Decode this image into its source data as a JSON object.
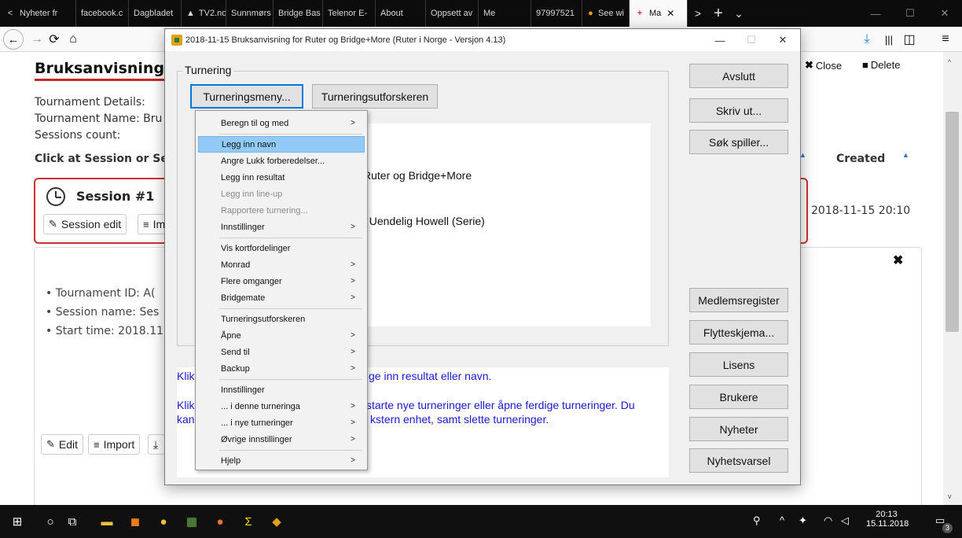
{
  "browser": {
    "tabs": [
      {
        "label": "Nyheter fr",
        "icon": "arrow-left-icon"
      },
      {
        "label": "facebook.c",
        "icon": ""
      },
      {
        "label": "Dagbladet",
        "icon": ""
      },
      {
        "label": "TV2.no",
        "icon": "warning-icon"
      },
      {
        "label": "Sunnmørs",
        "icon": ""
      },
      {
        "label": "Bridge Bas",
        "icon": ""
      },
      {
        "label": "Telenor E-",
        "icon": ""
      },
      {
        "label": "About",
        "icon": ""
      },
      {
        "label": "Oppsett av",
        "icon": ""
      },
      {
        "label": "Me",
        "icon": ""
      },
      {
        "label": "97997521",
        "icon": ""
      },
      {
        "label": "See wi",
        "icon": "firefox-icon"
      },
      {
        "label": "Ma",
        "icon": "plus-icon",
        "active": true
      }
    ],
    "new_tab": "+",
    "tab_overflow": ">",
    "tab_list": "⌄",
    "win_min": "—",
    "win_max": "☐",
    "win_close": "✕"
  },
  "page": {
    "title": "Bruksanvisning fo",
    "tournament_details": "Tournament Details:",
    "tournament_name": "Tournament Name: Bru",
    "sessions_count": "Sessions count:",
    "click_heading": "Click at Session or Sec",
    "created_header": "Created",
    "close_btn": "Close",
    "delete_btn": "Delete",
    "session": {
      "title": "Session #1",
      "edit_btn": "Session edit",
      "import_btn": "Im",
      "created": "2018-11-15 20:10"
    },
    "details": {
      "tournament_id": "Tournament ID: A(",
      "session_name": "Session name: Ses",
      "start_time": "Start time: 2018.11"
    },
    "edit_btn": "Edit",
    "import_btn": "Import"
  },
  "dialog": {
    "title": "2018-11-15  Bruksanvisning for Ruter og Bridge+More  (Ruter i Norge - Versjon 4.13)",
    "group_label": "Turnering",
    "btn_menu": "Turneringsmeny...",
    "btn_explorer": "Turneringsutforskeren",
    "panel_line1": "Ruter og Bridge+More",
    "panel_line2": ", Uendelig Howell (Serie)",
    "side_buttons": [
      "Avslutt",
      "Skriv ut...",
      "Søk spiller...",
      "Medlemsregister",
      "Flytteskjema...",
      "Lisens",
      "Brukere",
      "Nyheter",
      "Nyhetsvarsel"
    ],
    "bottom_text": {
      "line1_start": "Klik",
      "line1_end": "ge inn resultat eller navn.",
      "line2_start": "Klik",
      "line2_end": "starte nye turneringer eller åpne ferdige turneringer. Du",
      "line3_start": "kan",
      "line3_end": "kstern enhet, samt slette turneringer."
    }
  },
  "menu": {
    "items": [
      {
        "label": "Beregn til og med",
        "submenu": true
      },
      {
        "label": "Legg inn navn",
        "highlighted": true
      },
      {
        "label": "Angre Lukk forberedelser..."
      },
      {
        "label": "Legg inn resultat"
      },
      {
        "label": "Legg inn line-up",
        "disabled": true
      },
      {
        "label": "Rapportere turnering...",
        "disabled": true
      },
      {
        "label": "Innstillinger",
        "submenu": true
      },
      {
        "label": "Vis kortfordelinger"
      },
      {
        "label": "Monrad",
        "submenu": true
      },
      {
        "label": "Flere omganger",
        "submenu": true
      },
      {
        "label": "Bridgemate",
        "submenu": true
      },
      {
        "label": "Turneringsutforskeren"
      },
      {
        "label": "Åpne",
        "submenu": true
      },
      {
        "label": "Send til",
        "submenu": true
      },
      {
        "label": "Backup",
        "submenu": true
      },
      {
        "label": "Innstillinger"
      },
      {
        "label": "... i denne turneringa",
        "submenu": true
      },
      {
        "label": "... i nye turneringer",
        "submenu": true
      },
      {
        "label": "Øvrige innstillinger",
        "submenu": true
      },
      {
        "label": "Hjelp",
        "submenu": true
      }
    ]
  },
  "taskbar": {
    "time": "20:13",
    "date": "15.11.2018",
    "notification_count": "3"
  },
  "colors": {
    "accent_red": "#d32f2f",
    "menu_highlight": "#91c9f7",
    "link_blue": "#1a1ad1",
    "browser_dark": "#0c0c0d"
  }
}
